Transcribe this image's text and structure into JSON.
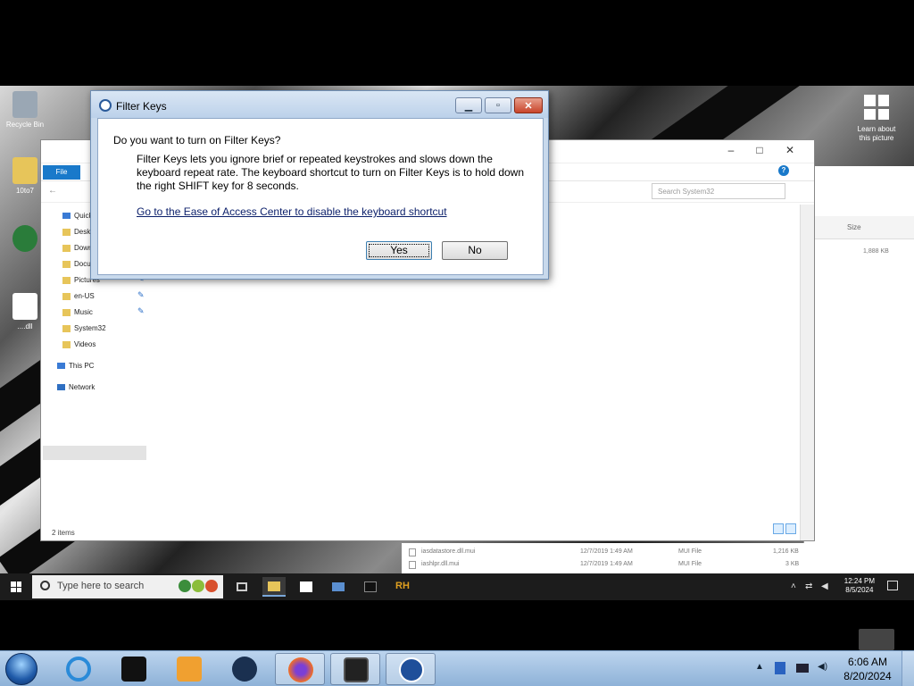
{
  "dialog": {
    "title": "Filter Keys",
    "question": "Do you want to turn on Filter Keys?",
    "description": "Filter Keys lets you ignore brief or repeated keystrokes and slows down the keyboard repeat rate.  The keyboard shortcut to turn on Filter Keys is to hold down the right SHIFT key for 8 seconds.",
    "link": "Go to the Ease of Access Center to disable the keyboard shortcut",
    "yes_label": "Yes",
    "no_label": "No"
  },
  "desktop_icons": {
    "recycle_bin": "Recycle Bin",
    "folder1": "10to7",
    "file1": "....dll",
    "learn_about": "Learn about this picture"
  },
  "explorer": {
    "file_tab": "File",
    "search_placeholder": "Search System32",
    "nav": {
      "quick_access": "Quick access",
      "desktop": "Desktop",
      "downloads": "Downloads",
      "documents": "Documents",
      "pictures": "Pictures",
      "en_us": "en-US",
      "music": "Music",
      "system32": "System32",
      "videos": "Videos",
      "this_pc": "This PC",
      "network": "Network"
    },
    "status": "2 items"
  },
  "back_explorer": {
    "size_header": "Size",
    "size_value": "1,888 KB",
    "files": [
      {
        "name": "iasdatastore.dll.mui",
        "date": "12/7/2019 1:49 AM",
        "type": "MUI File",
        "size": "1,216 KB"
      },
      {
        "name": "iashlpr.dll.mui",
        "date": "12/7/2019 1:49 AM",
        "type": "MUI File",
        "size": "3 KB"
      }
    ]
  },
  "inner_taskbar": {
    "search_placeholder": "Type here to search",
    "time": "12:24 PM",
    "date": "8/5/2024"
  },
  "outer_taskbar": {
    "time": "6:06 AM",
    "date": "8/20/2024"
  },
  "colors": {
    "dialog_frame": "#c8d9ec",
    "close_button": "#c8442a",
    "link": "#0b1f6a",
    "taskbar7": "#8eb2d8",
    "file_tab": "#1979ca"
  }
}
